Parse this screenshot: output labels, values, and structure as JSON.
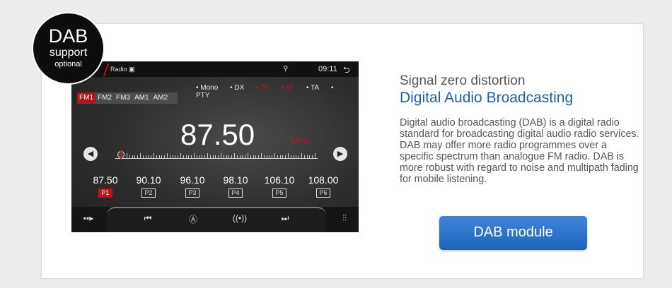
{
  "badge": {
    "line1": "DAB",
    "line2": "support",
    "line3": "optional"
  },
  "radio": {
    "status": {
      "app_label": "Radio",
      "time": "09:11"
    },
    "flags": [
      {
        "label": "Mono",
        "color": "#e6e6e6"
      },
      {
        "label": "DX",
        "color": "#e6e6e6"
      },
      {
        "label": "TP",
        "color": "#c0141c"
      },
      {
        "label": "AF",
        "color": "#c0141c"
      },
      {
        "label": "TA",
        "color": "#e6e6e6"
      },
      {
        "label": "PTY",
        "color": "#e6e6e6"
      }
    ],
    "bands": [
      "FM1",
      "FM2",
      "FM3",
      "AM1",
      "AM2"
    ],
    "active_band": "FM1",
    "frequency": "87.50",
    "unit": "MHz",
    "presets": [
      {
        "freq": "87.50",
        "label": "P1",
        "active": true
      },
      {
        "freq": "90.10",
        "label": "P2",
        "active": false
      },
      {
        "freq": "96.10",
        "label": "P3",
        "active": false
      },
      {
        "freq": "98.10",
        "label": "P4",
        "active": false
      },
      {
        "freq": "106.10",
        "label": "P5",
        "active": false
      },
      {
        "freq": "108.00",
        "label": "P6",
        "active": false
      }
    ],
    "bottom_icons": [
      "more-icon",
      "previous-icon",
      "auto-search-icon",
      "signal-icon",
      "next-icon",
      "equalizer-icon"
    ]
  },
  "content": {
    "subtitle": "Signal zero distortion",
    "title": "Digital Audio Broadcasting",
    "description": "Digital audio broadcasting (DAB) is a digital radio standard for broadcasting digital audio radio services. DAB may offer more radio programmes over a specific spectrum than analogue FM radio. DAB is more robust with regard to noise and multipath fading for mobile listening.",
    "button_label": "DAB module"
  },
  "colors": {
    "accent": "#1f5fa8",
    "button": "#2a71c8",
    "radio_red": "#c0141c"
  }
}
